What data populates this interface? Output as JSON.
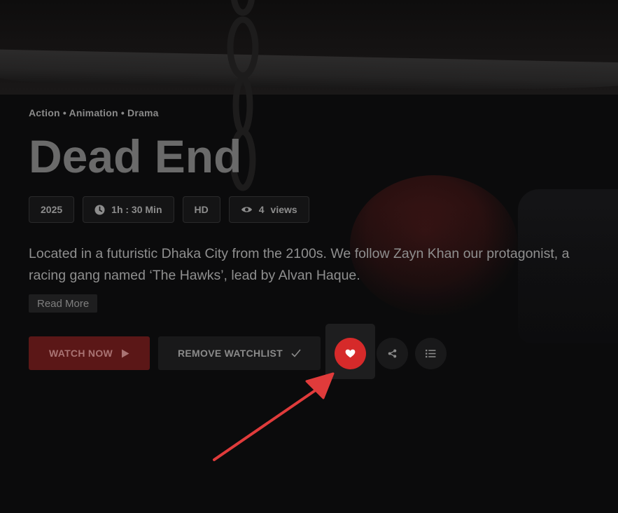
{
  "movie": {
    "genres": "Action • Animation • Drama",
    "title": "Dead End",
    "year": "2025",
    "duration": "1h : 30 Min",
    "quality": "HD",
    "views_count": "4",
    "views_label": "views",
    "description": "Located in a futuristic Dhaka City from the 2100s. We follow Zayn Khan our protagonist, a\nracing gang named ‘The Hawks’, lead by Alvan Haque."
  },
  "actions": {
    "read_more": "Read More",
    "watch_now": "WATCH NOW",
    "remove_watchlist": "REMOVE WATCHLIST",
    "watch_now_icon": "play-icon",
    "remove_watchlist_icon": "check-icon",
    "favorite_icon": "heart-icon",
    "share_icon": "share-icon",
    "playlist_icon": "list-icon"
  },
  "colors": {
    "favorite_active": "#d62a2a",
    "watch_now_bg": "#5b1717",
    "annotation_arrow": "#e03b3b"
  }
}
